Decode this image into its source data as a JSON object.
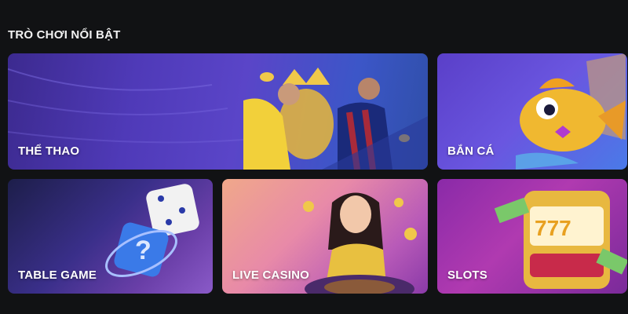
{
  "section": {
    "title": "TRÒ CHƠI NỔI BẬT"
  },
  "cards": [
    {
      "id": "sports",
      "label": "THỂ THAO"
    },
    {
      "id": "fishing",
      "label": "BẮN CÁ"
    },
    {
      "id": "table",
      "label": "TABLE GAME"
    },
    {
      "id": "casino",
      "label": "LIVE CASINO"
    },
    {
      "id": "slots",
      "label": "SLOTS"
    }
  ],
  "colors": {
    "background": "#111214",
    "text": "#ffffff"
  }
}
